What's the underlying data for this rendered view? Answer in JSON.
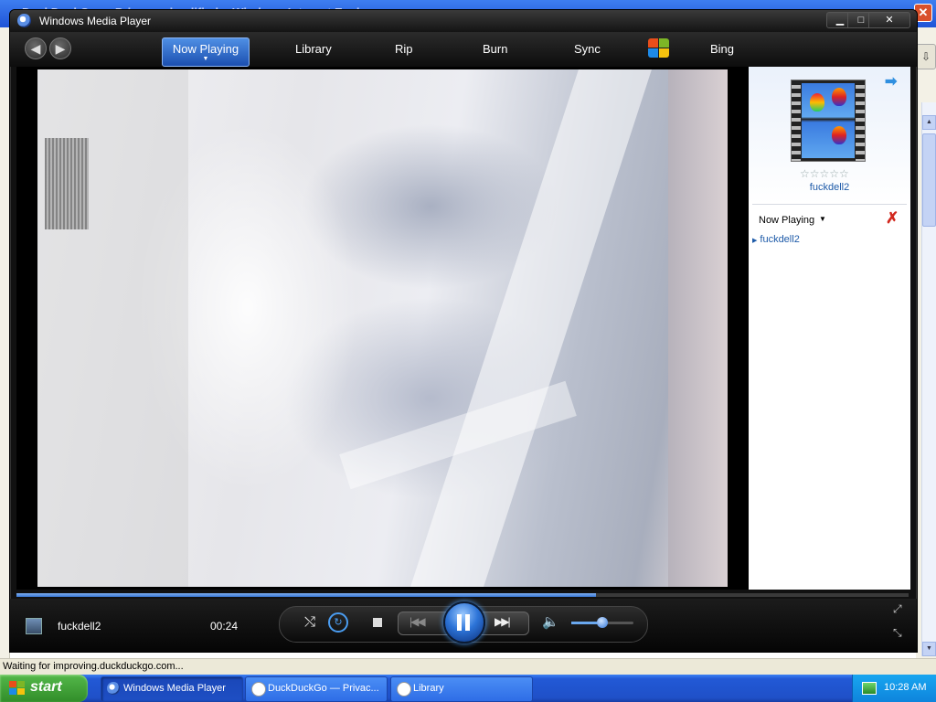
{
  "background_browser": {
    "title": "DuckDuckGo — Privacy, simplified. - Windows Internet Explorer",
    "status_text": "Waiting for improving.duckduckgo.com..."
  },
  "wmp": {
    "title": "Windows Media Player",
    "window_controls": {
      "minimize": "▁",
      "maximize": "□",
      "close": "✕"
    },
    "nav": {
      "back": "◀",
      "forward": "▶",
      "tabs": [
        {
          "label": "Now Playing",
          "active": true
        },
        {
          "label": "Library"
        },
        {
          "label": "Rip"
        },
        {
          "label": "Burn"
        },
        {
          "label": "Sync"
        },
        {
          "label": "Bing"
        }
      ]
    },
    "side_panel": {
      "arrow": "➡",
      "rating_stars": "☆☆☆☆☆",
      "album_title": "fuckdell2",
      "playlist_header": "Now Playing",
      "playlist_caret": "▼",
      "clear_icon": "✗",
      "playlist_items": [
        "fuckdell2"
      ]
    },
    "player": {
      "track_name": "fuckdell2",
      "time": "00:24",
      "seek_fraction": 0.65,
      "volume_fraction": 0.5,
      "state": "playing"
    },
    "controls": {
      "shuffle": "⤭",
      "repeat": "↻",
      "prev": "|◀◀",
      "next": "▶▶|",
      "mute": "🔈",
      "fullscreen": "⤢",
      "compact": "⤡"
    }
  },
  "taskbar": {
    "start_label": "start",
    "buttons": [
      {
        "label": "Windows Media Player",
        "active": true
      },
      {
        "label": "DuckDuckGo — Privac..."
      },
      {
        "label": "Library"
      }
    ],
    "clock": "10:28 AM"
  },
  "colors": {
    "wmp_accent": "#2d74d8",
    "taskbar": "#2259d6",
    "start_green": "#3c9a33"
  }
}
